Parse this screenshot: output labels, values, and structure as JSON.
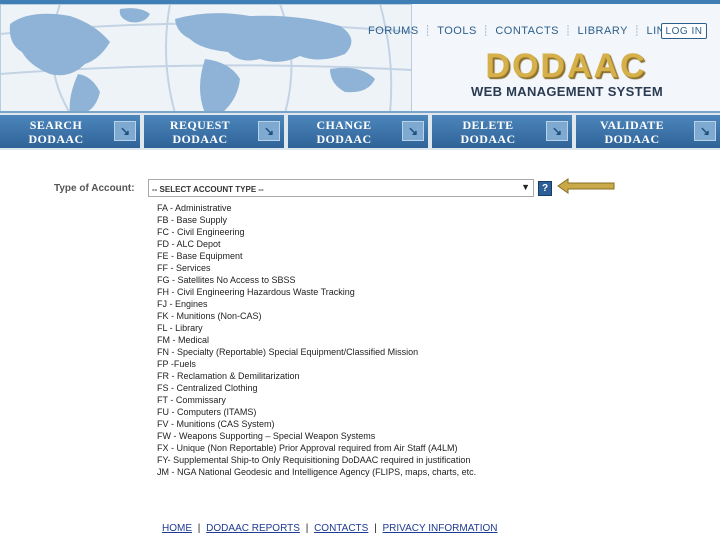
{
  "header": {
    "topnav": [
      "FORUMS",
      "TOOLS",
      "CONTACTS",
      "LIBRARY",
      "LINKS"
    ],
    "login_label": "LOG IN",
    "logo_text": "DODAAC",
    "tagline": "WEB MANAGEMENT SYSTEM"
  },
  "nav": [
    {
      "line1": "SEARCH",
      "line2": "DODAAC"
    },
    {
      "line1": "REQUEST",
      "line2": "DODAAC"
    },
    {
      "line1": "CHANGE",
      "line2": "DODAAC"
    },
    {
      "line1": "DELETE",
      "line2": "DODAAC"
    },
    {
      "line1": "VALIDATE",
      "line2": "DODAAC"
    }
  ],
  "form": {
    "type_label": "Type of Account:",
    "select_value": "-- SELECT ACCOUNT TYPE --",
    "help_label": "?"
  },
  "options": [
    "FA - Administrative",
    "FB - Base Supply",
    "FC - Civil Engineering",
    "FD - ALC Depot",
    "FE - Base Equipment",
    "FF - Services",
    "FG - Satellites  No Access to SBSS",
    "FH - Civil Engineering Hazardous Waste Tracking",
    "FJ - Engines",
    "FK - Munitions (Non-CAS)",
    "FL - Library",
    "FM - Medical",
    "FN - Specialty  (Reportable)  Special Equipment/Classified Mission",
    "FP -Fuels",
    "FR - Reclamation & Demilitarization",
    "FS - Centralized Clothing",
    "FT - Commissary",
    "FU - Computers (ITAMS)",
    "FV - Munitions (CAS System)",
    "FW - Weapons Supporting – Special Weapon Systems",
    "FX - Unique (Non Reportable)  Prior Approval required from Air Staff (A4LM)",
    "FY- Supplemental Ship-to Only  Requisitioning DoDAAC required in justification",
    "JM - NGA National Geodesic and Intelligence Agency (FLIPS, maps, charts, etc."
  ],
  "footer": {
    "links": [
      "HOME",
      "DODAAC REPORTS",
      "CONTACTS",
      "PRIVACY INFORMATION"
    ],
    "separator": "|"
  },
  "colors": {
    "nav_blue": "#3a72a8",
    "logo_gold": "#d6b04a",
    "arrow_gold": "#c9a949",
    "link_blue": "#1f3a93"
  }
}
